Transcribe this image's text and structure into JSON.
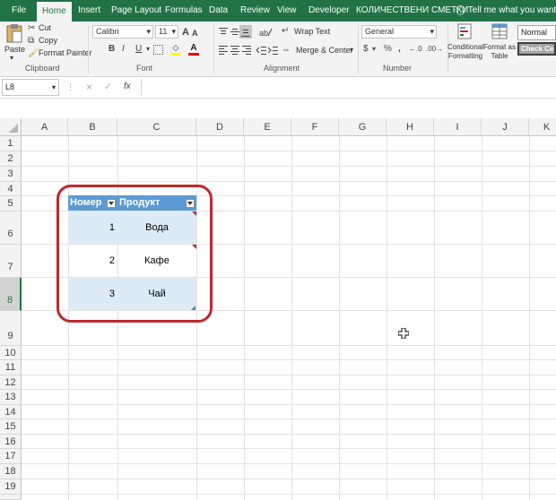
{
  "ribbon_tabs": [
    {
      "label": "File"
    },
    {
      "label": "Home"
    },
    {
      "label": "Insert"
    },
    {
      "label": "Page Layout"
    },
    {
      "label": "Formulas"
    },
    {
      "label": "Data"
    },
    {
      "label": "Review"
    },
    {
      "label": "View"
    },
    {
      "label": "Developer"
    },
    {
      "label": "КОЛИЧЕСТВЕНИ СМЕТКИ"
    }
  ],
  "tell_me": "Tell me what you want to do",
  "clipboard": {
    "paste": "Paste",
    "cut": "Cut",
    "copy": "Copy",
    "format_painter": "Format Painter",
    "label": "Clipboard"
  },
  "font": {
    "name": "Calibri",
    "size": "11",
    "bold": "B",
    "italic": "I",
    "underline": "U",
    "grow": "A",
    "shrink": "A",
    "label": "Font"
  },
  "alignment": {
    "wrap_text": "Wrap Text",
    "merge_center": "Merge & Center",
    "label": "Alignment"
  },
  "number": {
    "format": "General",
    "currency": "$",
    "percent": "%",
    "comma": ",",
    "label": "Number"
  },
  "styles": {
    "conditional": "Conditional Formatting",
    "format_as": "Format as Table",
    "normal": "Normal",
    "check_cell": "Check Cell"
  },
  "formula_bar": {
    "name_box": "L8",
    "fx": "fx",
    "cancel": "×",
    "enter": "✓",
    "value": ""
  },
  "columns": [
    "A",
    "B",
    "C",
    "D",
    "E",
    "F",
    "G",
    "H",
    "I",
    "J",
    "K"
  ],
  "rows": [
    "1",
    "2",
    "3",
    "4",
    "5",
    "6",
    "7",
    "8",
    "9",
    "10",
    "11",
    "12",
    "13",
    "14",
    "15",
    "16",
    "17",
    "18",
    "19"
  ],
  "selected_row": "8",
  "table": {
    "headers": [
      "Номер",
      "Продукт"
    ],
    "rows": [
      {
        "num": "1",
        "product": "Вода"
      },
      {
        "num": "2",
        "product": "Кафе"
      },
      {
        "num": "3",
        "product": "Чай"
      }
    ],
    "header_color": "#5b9bd5",
    "band_color": "#ddebf7"
  },
  "annotation_color": "#c0272d",
  "accent": "#217346"
}
